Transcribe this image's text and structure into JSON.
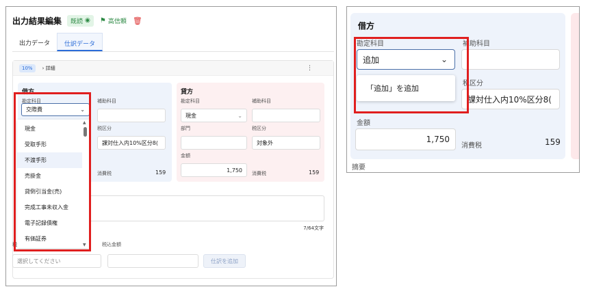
{
  "header": {
    "title": "出力結果編集",
    "read_badge": "既読",
    "high_reliability": "高信頼"
  },
  "tabs": [
    {
      "label": "出力データ"
    },
    {
      "label": "仕訳データ"
    }
  ],
  "card": {
    "pct": "10%",
    "detail": "詳細"
  },
  "debit": {
    "title": "借方",
    "account_label": "勘定科目",
    "account_value": "交際費",
    "sub_account_label": "補助科目",
    "tax_label": "税区分",
    "tax_value": "課対仕入内10%区分8(",
    "consumption_tax_label": "消費税",
    "consumption_tax_value": "159"
  },
  "credit": {
    "title": "貸方",
    "account_label": "勘定科目",
    "account_value": "現金",
    "sub_account_label": "補助科目",
    "dept_label": "部門",
    "tax_label": "税区分",
    "tax_value": "対象外",
    "amount_label": "金額",
    "amount_value": "1,750",
    "consumption_tax_label": "消費税",
    "consumption_tax_value": "159"
  },
  "memo": {
    "count": "7/64文字"
  },
  "bottom": {
    "tax_label": "税",
    "amount_label": "税込金額",
    "select_placeholder": "選択してください",
    "add_button": "仕訳を追加"
  },
  "dropdown": {
    "items": [
      "現金",
      "受取手形",
      "不渡手形",
      "売掛金",
      "貸倒引当金(売)",
      "完成工事未収入金",
      "電子記録債権",
      "有価証券"
    ],
    "highlighted_index": 2
  },
  "zoom": {
    "title": "借方",
    "account_label": "勘定科目",
    "account_value": "追加",
    "sub_account_label": "補助科目",
    "tax_label": "税区分",
    "tax_value": "課対仕入内10%区分8(",
    "popup_option": "「追加」を追加",
    "amount_label": "金額",
    "amount_value": "1,750",
    "consumption_tax_label": "消費税",
    "consumption_tax_value": "159",
    "memo_label": "摘要"
  },
  "colors": {
    "accent": "#2a6cd8",
    "highlight_frame": "#e01e1e",
    "debit_bg": "#eef3fb",
    "credit_bg": "#fdf0f1"
  }
}
